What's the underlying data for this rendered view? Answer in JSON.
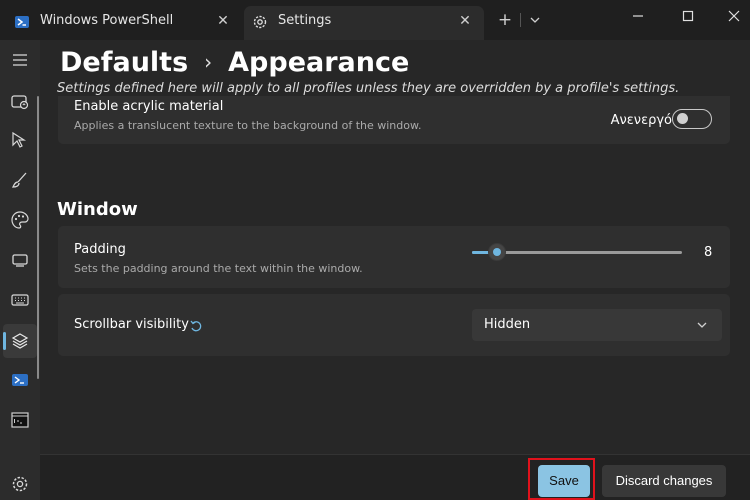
{
  "titlebar": {
    "tabs": [
      {
        "label": "Windows PowerShell",
        "active": false
      },
      {
        "label": "Settings",
        "active": true
      }
    ],
    "new_tab_glyph": "+",
    "close_glyph": "✕"
  },
  "sidebar": {
    "items": [
      "menu-icon",
      "startup-icon",
      "interaction-icon",
      "appearance-icon",
      "color-schemes-icon",
      "rendering-icon",
      "actions-icon",
      "defaults-icon",
      "powershell-icon",
      "command-prompt-icon"
    ],
    "selected": "defaults-icon"
  },
  "header": {
    "crumb_parent": "Defaults",
    "crumb_separator": "›",
    "crumb_current": "Appearance",
    "subtitle": "Settings defined here will apply to all profiles unless they are overridden by a profile's settings."
  },
  "acrylic": {
    "title": "Enable acrylic material",
    "description": "Applies a translucent texture to the background of the window.",
    "toggle_label": "Ανενεργό",
    "toggle_on": false
  },
  "window_section": {
    "title": "Window",
    "padding": {
      "title": "Padding",
      "description": "Sets the padding around the text within the window.",
      "value": "8",
      "slider_fraction": 0.12
    },
    "scrollbar": {
      "title": "Scrollbar visibility",
      "selected": "Hidden"
    }
  },
  "footer": {
    "save_label": "Save",
    "discard_label": "Discard changes"
  },
  "colors": {
    "accent": "#6fb6e0",
    "save_button": "#8bc4e3",
    "highlight": "#e0121c"
  }
}
